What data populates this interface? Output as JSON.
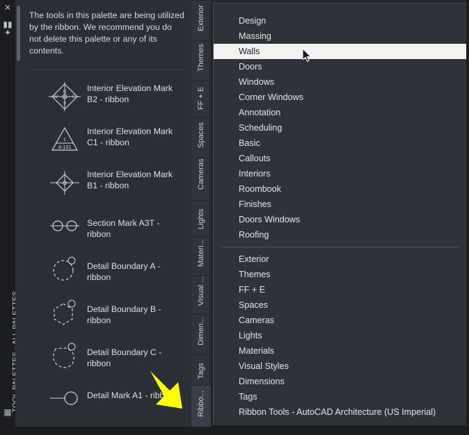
{
  "window": {
    "vertical_title": "TOOL PALETTES - ALL PALETTES",
    "icons": {
      "close": "close-icon",
      "dock": "dock-icon",
      "menu": "menu-icon",
      "properties": "properties-icon",
      "lock": "lock-icon"
    }
  },
  "palette": {
    "note": "The tools in this palette are being utilized by the ribbon. We recommend you do not delete this palette or any of its contents.",
    "tools": [
      {
        "label": "Interior Elevation Mark B2 - ribbon",
        "icon": "diamond-elevation-mark-icon",
        "two_line": true
      },
      {
        "label": "Interior Elevation Mark C1 - ribbon",
        "icon": "triangle-elevation-mark-icon",
        "two_line": true
      },
      {
        "label": "Interior Elevation Mark B1 - ribbon",
        "icon": "diamond-small-elevation-mark-icon",
        "two_line": true
      },
      {
        "label": "Section Mark A3T - ribbon",
        "icon": "section-mark-icon",
        "two_line": false
      },
      {
        "label": "Detail Boundary A - ribbon",
        "icon": "detail-boundary-circle-icon",
        "two_line": false
      },
      {
        "label": "Detail Boundary B - ribbon",
        "icon": "detail-boundary-polygon-icon",
        "two_line": false
      },
      {
        "label": "Detail Boundary C - ribbon",
        "icon": "detail-boundary-freeform-icon",
        "two_line": false
      },
      {
        "label": "Detail Mark A1 - ribbon",
        "icon": "detail-mark-icon",
        "two_line": false
      }
    ]
  },
  "tabstrip": {
    "tabs": [
      {
        "label": "Exterior",
        "active": false
      },
      {
        "label": "Themes",
        "active": false
      },
      {
        "label": "FF + E",
        "active": false
      },
      {
        "label": "Spaces",
        "active": false
      },
      {
        "label": "Cameras",
        "active": false
      },
      {
        "label": "Lights",
        "active": false
      },
      {
        "label": "Materi...",
        "active": false
      },
      {
        "label": "Visual ...",
        "active": false
      },
      {
        "label": "Dimen...",
        "active": false
      },
      {
        "label": "Tags",
        "active": false
      },
      {
        "label": "Ribbo...",
        "active": true
      }
    ]
  },
  "context_menu": {
    "group_one": [
      "Design",
      "Massing",
      "Walls",
      "Doors",
      "Windows",
      "Corner Windows",
      "Annotation",
      "Scheduling",
      "Basic",
      "Callouts",
      "Interiors",
      "Roombook",
      "Finishes",
      "Doors  Windows",
      "Roofing"
    ],
    "highlighted": "Walls",
    "group_two": [
      "Exterior",
      "Themes",
      "FF + E",
      "Spaces",
      "Cameras",
      "Lights",
      "Materials",
      "Visual Styles",
      "Dimensions",
      "Tags",
      "Ribbon Tools - AutoCAD Architecture (US Imperial)"
    ]
  },
  "annotation": {
    "arrow_color": "#ffff00",
    "points_to": "Ribbo... tab"
  }
}
